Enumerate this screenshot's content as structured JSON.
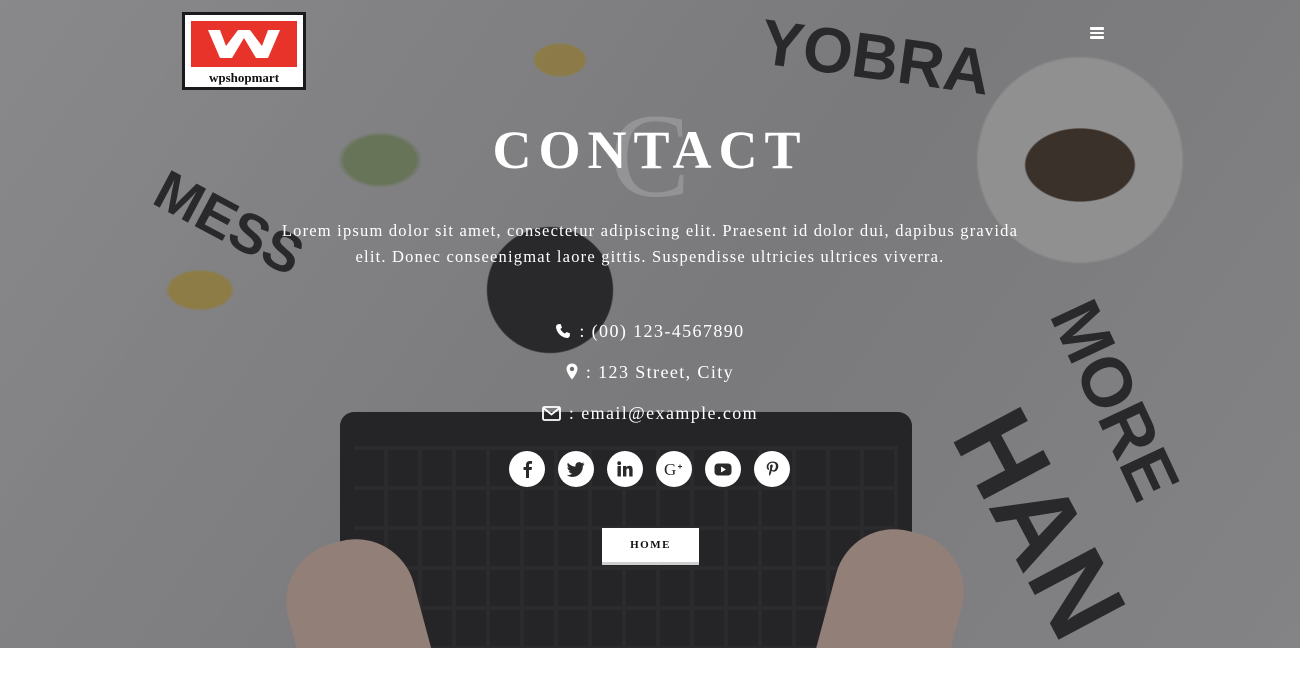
{
  "brand": {
    "logo_text": "wpshopmart",
    "logo_letter": "W",
    "accent_color": "#e8332a"
  },
  "header": {
    "menu_icon": "hamburger-menu-icon"
  },
  "hero": {
    "title": "CONTACT",
    "title_ghost": "C",
    "description_line1": "Lorem ipsum dolor sit amet, consectetur adipiscing elit. Praesent id dolor dui, dapibus gravida",
    "description_line2": "elit. Donec conseenigmat laore gittis. Suspendisse ultricies ultrices viverra."
  },
  "contact": {
    "phone": ": (00) 123-4567890",
    "address": ": 123 Street, City",
    "email": ": email@example.com"
  },
  "socials": [
    {
      "name": "facebook",
      "icon": "facebook-icon"
    },
    {
      "name": "twitter",
      "icon": "twitter-icon"
    },
    {
      "name": "linkedin",
      "icon": "linkedin-icon"
    },
    {
      "name": "google-plus",
      "icon": "google-plus-icon"
    },
    {
      "name": "youtube",
      "icon": "youtube-icon"
    },
    {
      "name": "pinterest",
      "icon": "pinterest-icon"
    }
  ],
  "home_button": {
    "label": "HOME"
  }
}
